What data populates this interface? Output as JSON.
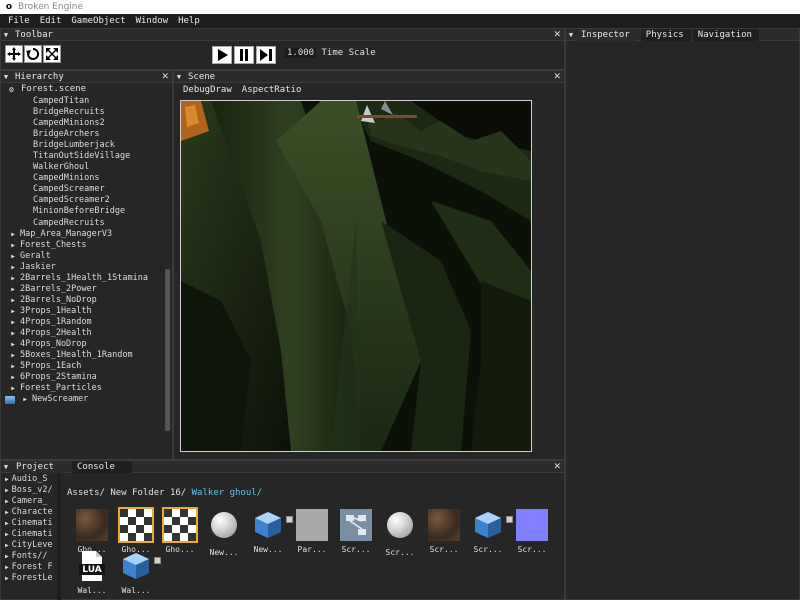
{
  "window": {
    "title": "Broken Engine",
    "app_icon": "o"
  },
  "menu": [
    "File",
    "Edit",
    "GameObject",
    "Window",
    "Help"
  ],
  "toolbar": {
    "title": "Toolbar",
    "tools": [
      "move-tool-icon",
      "rotate-tool-icon",
      "scale-tool-icon"
    ],
    "controls": [
      "play-icon",
      "pause-icon",
      "step-icon"
    ],
    "time_scale_value": "1.000",
    "time_scale_label": "Time Scale"
  },
  "inspector": {
    "tabs": [
      "Inspector",
      "Physics",
      "Navigation"
    ],
    "active_tab": "Physics"
  },
  "hierarchy": {
    "title": "Hierarchy",
    "scene_name": "Forest.scene",
    "items": [
      {
        "label": "CampedTitan",
        "expandable": false,
        "indent": 2
      },
      {
        "label": "BridgeRecruits",
        "expandable": false,
        "indent": 2
      },
      {
        "label": "CampedMinions2",
        "expandable": false,
        "indent": 2
      },
      {
        "label": "BridgeArchers",
        "expandable": false,
        "indent": 2
      },
      {
        "label": "BridgeLumberjack",
        "expandable": false,
        "indent": 2
      },
      {
        "label": "TitanOutSideVillage",
        "expandable": false,
        "indent": 2
      },
      {
        "label": "WalkerGhoul",
        "expandable": false,
        "indent": 2
      },
      {
        "label": "CampedMinions",
        "expandable": false,
        "indent": 2
      },
      {
        "label": "CampedScreamer",
        "expandable": false,
        "indent": 2
      },
      {
        "label": "CampedScreamer2",
        "expandable": false,
        "indent": 2
      },
      {
        "label": "MinionBeforeBridge",
        "expandable": false,
        "indent": 2
      },
      {
        "label": "CampedRecruits",
        "expandable": false,
        "indent": 2
      },
      {
        "label": "Map_Area_ManagerV3",
        "expandable": true,
        "indent": 1
      },
      {
        "label": "Forest_Chests",
        "expandable": true,
        "indent": 1
      },
      {
        "label": "Geralt",
        "expandable": true,
        "indent": 1
      },
      {
        "label": "Jaskier",
        "expandable": true,
        "indent": 1
      },
      {
        "label": "2Barrels_1Health_1Stamina",
        "expandable": true,
        "indent": 1
      },
      {
        "label": "2Barrels_2Power",
        "expandable": true,
        "indent": 1
      },
      {
        "label": "2Barrels_NoDrop",
        "expandable": true,
        "indent": 1
      },
      {
        "label": "3Props_1Health",
        "expandable": true,
        "indent": 1
      },
      {
        "label": "4Props_1Random",
        "expandable": true,
        "indent": 1
      },
      {
        "label": "4Props_2Health",
        "expandable": true,
        "indent": 1
      },
      {
        "label": "4Props_NoDrop",
        "expandable": true,
        "indent": 1
      },
      {
        "label": "5Boxes_1Health_1Random",
        "expandable": true,
        "indent": 1
      },
      {
        "label": "5Props_1Each",
        "expandable": true,
        "indent": 1
      },
      {
        "label": "6Props_2Stamina",
        "expandable": true,
        "indent": 1
      },
      {
        "label": "Forest_Particles",
        "expandable": true,
        "indent": 1
      },
      {
        "label": "NewScreamer",
        "expandable": true,
        "indent": 1,
        "has_prefab_icon": true
      }
    ]
  },
  "scene": {
    "title": "Scene",
    "options": [
      "DebugDraw",
      "AspectRatio"
    ]
  },
  "project": {
    "tabs": [
      "Project",
      "Console"
    ],
    "tree": [
      "Audio_S",
      "Boss_v2/",
      "Camera_",
      "Characte",
      "Cinemati",
      "Cinemati",
      "CityLeve",
      "Fonts//",
      "Forest F",
      "ForestLe"
    ],
    "path": {
      "parts": "Assets/ New Folder 16/",
      "current": "Walker ghoul/"
    },
    "assets": [
      {
        "name": "Gho...",
        "icon": "texture-bark-icon"
      },
      {
        "name": "Gho...",
        "icon": "checker-texture-icon",
        "selected": true
      },
      {
        "name": "Gho...",
        "icon": "checker-texture-icon",
        "selected": true
      },
      {
        "name": "New...",
        "icon": "sphere-material-icon"
      },
      {
        "name": "New...",
        "icon": "cube-prefab-icon"
      },
      {
        "name": "Par...",
        "icon": "particle-icon"
      },
      {
        "name": "Scr...",
        "icon": "script-graph-icon"
      },
      {
        "name": "Scr...",
        "icon": "sphere-material-icon"
      },
      {
        "name": "Scr...",
        "icon": "texture-bark-icon"
      },
      {
        "name": "Scr...",
        "icon": "cube-prefab-icon"
      },
      {
        "name": "Scr...",
        "icon": "normal-map-icon"
      },
      {
        "name": "Wal...",
        "icon": "lua-file-icon",
        "label": "LUA"
      },
      {
        "name": "Wal...",
        "icon": "cube-prefab-icon"
      }
    ]
  },
  "colors": {
    "accent_path": "#67c3e6",
    "panel_bg": "#262626",
    "menu_bg": "#1e1e1e"
  }
}
